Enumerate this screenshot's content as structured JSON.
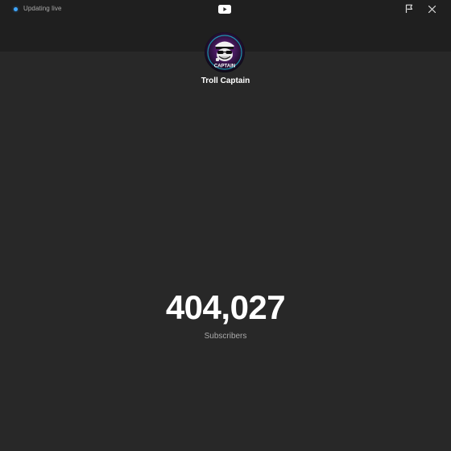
{
  "header": {
    "status_text": "Updating live",
    "status_color": "#3ea6ff",
    "logo_icon": "youtube-logo-icon",
    "pin_icon": "pin-icon",
    "close_icon": "close-icon"
  },
  "channel": {
    "name": "Troll Captain",
    "avatar_text": "CAPTAIN"
  },
  "stats": {
    "subscriber_count": "404,027",
    "subscriber_label": "Subscribers"
  },
  "colors": {
    "background": "#282828",
    "header_background": "#1f1f1f",
    "text_primary": "#ffffff",
    "text_secondary": "#aaaaaa"
  }
}
